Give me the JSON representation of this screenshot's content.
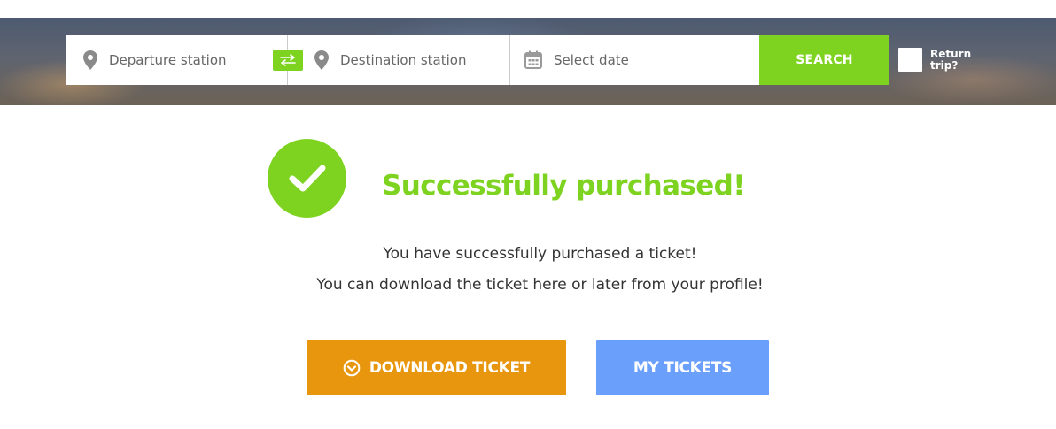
{
  "search": {
    "departure_placeholder": "Departure station",
    "destination_placeholder": "Destination station",
    "date_placeholder": "Select date",
    "search_label": "SEARCH",
    "return_trip_label": "Return trip?",
    "return_trip_checked": false,
    "icons": {
      "departure": "map-pin-icon",
      "swap": "swap-arrows-icon",
      "destination": "map-pin-icon",
      "date": "calendar-icon"
    }
  },
  "confirmation": {
    "icon": "checkmark-icon",
    "title": "Successfully purchased!",
    "message_line1": "You have successfully purchased a ticket!",
    "message_line2": "You can download the ticket here or later from your profile!"
  },
  "actions": {
    "download_label": "DOWNLOAD TICKET",
    "download_icon": "chevron-down-circle-icon",
    "my_tickets_label": "MY TICKETS"
  },
  "colors": {
    "accent_green": "#7ed321",
    "download_orange": "#e8960e",
    "my_tickets_blue": "#6b9ffc",
    "text": "#333333"
  }
}
